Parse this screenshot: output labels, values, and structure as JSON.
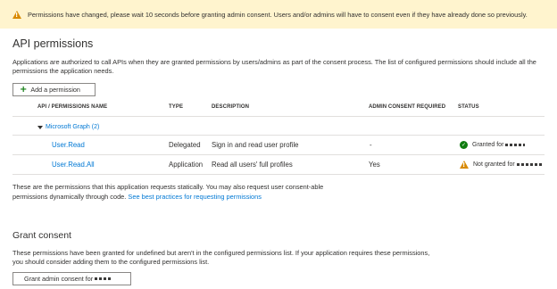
{
  "banner": {
    "icon": "warning-icon",
    "message": "Permissions have changed, please wait 10 seconds before granting admin consent. Users and/or admins will have to consent even if they have already done so previously."
  },
  "api_permissions": {
    "title": "API permissions",
    "description": "Applications are authorized to call APIs when they are granted permissions by users/admins as part of the consent process. The list of configured permissions should include all the permissions the application needs.",
    "add_button": {
      "icon": "plus-icon",
      "label": "Add a permission"
    },
    "columns": [
      "API / PERMISSIONS NAME",
      "TYPE",
      "DESCRIPTION",
      "ADMIN CONSENT REQUIRED",
      "STATUS"
    ],
    "group": {
      "label": "Microsoft Graph (2)"
    },
    "rows": [
      {
        "name": "User.Read",
        "type": "Delegated",
        "description": "Sign in and read user profile",
        "admin_consent": "-",
        "status": "Granted for",
        "status_icon": "check-circle-icon",
        "status_color": "#107c10"
      },
      {
        "name": "User.Read.All",
        "type": "Application",
        "description": "Read all users' full profiles",
        "admin_consent": "Yes",
        "status": "Not granted for",
        "status_icon": "warning-icon",
        "status_color": "#d88a00"
      }
    ],
    "note": "These are the permissions that this application requests statically. You may also request user consent-able permissions dynamically through code.",
    "note_link": "See best practices for requesting permissions"
  },
  "grant_consent": {
    "title": "Grant consent",
    "description": "These permissions have been granted for undefined but aren't in the configured permissions list. If your application requires these permissions, you should consider adding them to the configured permissions list.",
    "button_label": "Grant admin consent for"
  },
  "colors": {
    "banner_bg": "#fff4ce",
    "link": "#0078d4",
    "success": "#107c10",
    "warning": "#d88a00"
  }
}
